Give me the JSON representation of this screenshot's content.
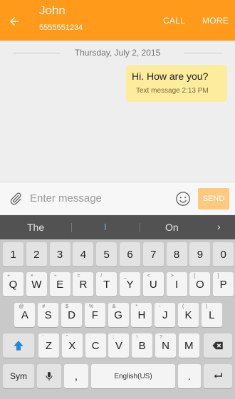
{
  "header": {
    "contact_name": "John",
    "contact_number": "5555551234",
    "call_label": "CALL",
    "more_label": "MORE"
  },
  "conversation": {
    "date": "Thursday, July 2, 2015",
    "messages": [
      {
        "text": "Hi. How are you?",
        "meta": "Text message 2:13 PM"
      }
    ]
  },
  "compose": {
    "placeholder": "Enter message",
    "value": "",
    "send_label": "SEND"
  },
  "suggestions": [
    "The",
    "I",
    "On"
  ],
  "keyboard": {
    "row1": [
      "1",
      "2",
      "3",
      "4",
      "5",
      "6",
      "7",
      "8",
      "9",
      "0"
    ],
    "row2": [
      "Q",
      "W",
      "E",
      "R",
      "T",
      "Y",
      "U",
      "I",
      "O",
      "P"
    ],
    "row2_hints": [
      "+",
      "×",
      "÷",
      "=",
      "/",
      "_",
      "<",
      ">",
      "[",
      "]"
    ],
    "row3": [
      "A",
      "S",
      "D",
      "F",
      "G",
      "H",
      "J",
      "K",
      "L"
    ],
    "row3_hints": [
      "@",
      "#",
      "$",
      "%",
      "&",
      "*",
      "-",
      "(",
      ")"
    ],
    "row4": [
      "Z",
      "X",
      "C",
      "V",
      "B",
      "N",
      "M"
    ],
    "row4_hints": [
      "'",
      "\"",
      ":",
      ";",
      "!",
      "?",
      ""
    ],
    "sym_label": "Sym",
    "comma_label": ",",
    "space_label": "English(US)",
    "period_label": ".",
    "colors": {
      "accent": "#ff9a1a",
      "shift": "#1e88e5"
    }
  }
}
